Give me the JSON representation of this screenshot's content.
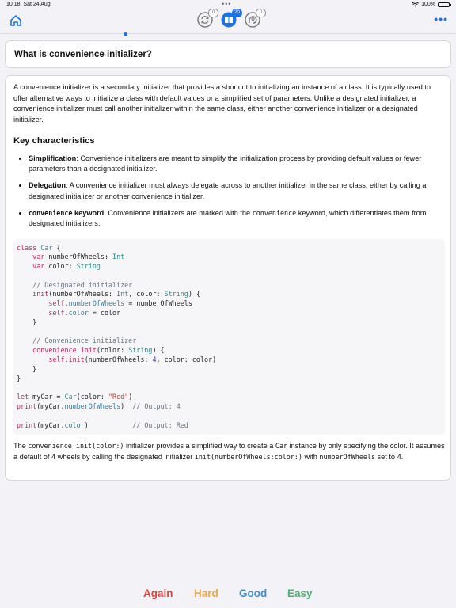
{
  "status_bar": {
    "time": "10:18",
    "date": "Sat 24 Aug",
    "battery": "100%",
    "battery_level": 1.0
  },
  "toolbar": {
    "home_icon": "house-icon",
    "more_icon": "ellipsis-icon",
    "badges": {
      "repeat": "0",
      "cards": "20",
      "brain": "0"
    }
  },
  "question": "What is convenience initializer?",
  "answer": {
    "intro": "A convenience initializer is a secondary initializer that provides a shortcut to initializing an instance of a class. It is typically used to offer alternative ways to initialize a class with default values or a simplified set of parameters. Unlike a designated initializer, a convenience initializer must call another initializer within the same class, either another convenience initializer or a designated initializer.",
    "heading": "Key characteristics",
    "bullets": [
      {
        "term": "Simplification",
        "text": ": Convenience initializers are meant to simplify the initialization process by providing default values or fewer parameters than a designated initializer."
      },
      {
        "term": "Delegation",
        "text": ": A convenience initializer must always delegate across to another initializer in the same class, either by calling a designated initializer or another convenience initializer."
      },
      {
        "term": "convenience",
        "term_suffix": " keyword",
        "text": ": Convenience initializers are marked with the ",
        "code": "convenience",
        "text2": " keyword, which differentiates them from designated initializers."
      }
    ],
    "code_lines": [
      "class Car {",
      "    var numberOfWheels: Int",
      "    var color: String",
      "",
      "    // Designated initializer",
      "    init(numberOfWheels: Int, color: String) {",
      "        self.numberOfWheels = numberOfWheels",
      "        self.color = color",
      "    }",
      "",
      "    // Convenience initializer",
      "    convenience init(color: String) {",
      "        self.init(numberOfWheels: 4, color: color)",
      "    }",
      "}",
      "",
      "let myCar = Car(color: \"Red\")",
      "print(myCar.numberOfWheels)  // Output: 4",
      "",
      "print(myCar.color)           // Output: Red"
    ],
    "outro": {
      "t1": "The ",
      "c1": "convenience init(color:)",
      "t2": " initializer provides a simplified way to create a ",
      "c2": "Car",
      "t3": " instance by only specifying the color. It assumes a default of 4 wheels by calling the designated initializer ",
      "c3": "init(numberOfWheels:color:)",
      "t4": " with ",
      "c4": "numberOfWheels",
      "t5": " set to 4."
    }
  },
  "rating": {
    "again": {
      "label": "Again",
      "color": "#d9463e"
    },
    "hard": {
      "label": "Hard",
      "color": "#f0a93b"
    },
    "good": {
      "label": "Good",
      "color": "#3d8ec9"
    },
    "easy": {
      "label": "Easy",
      "color": "#4caf6e"
    }
  }
}
